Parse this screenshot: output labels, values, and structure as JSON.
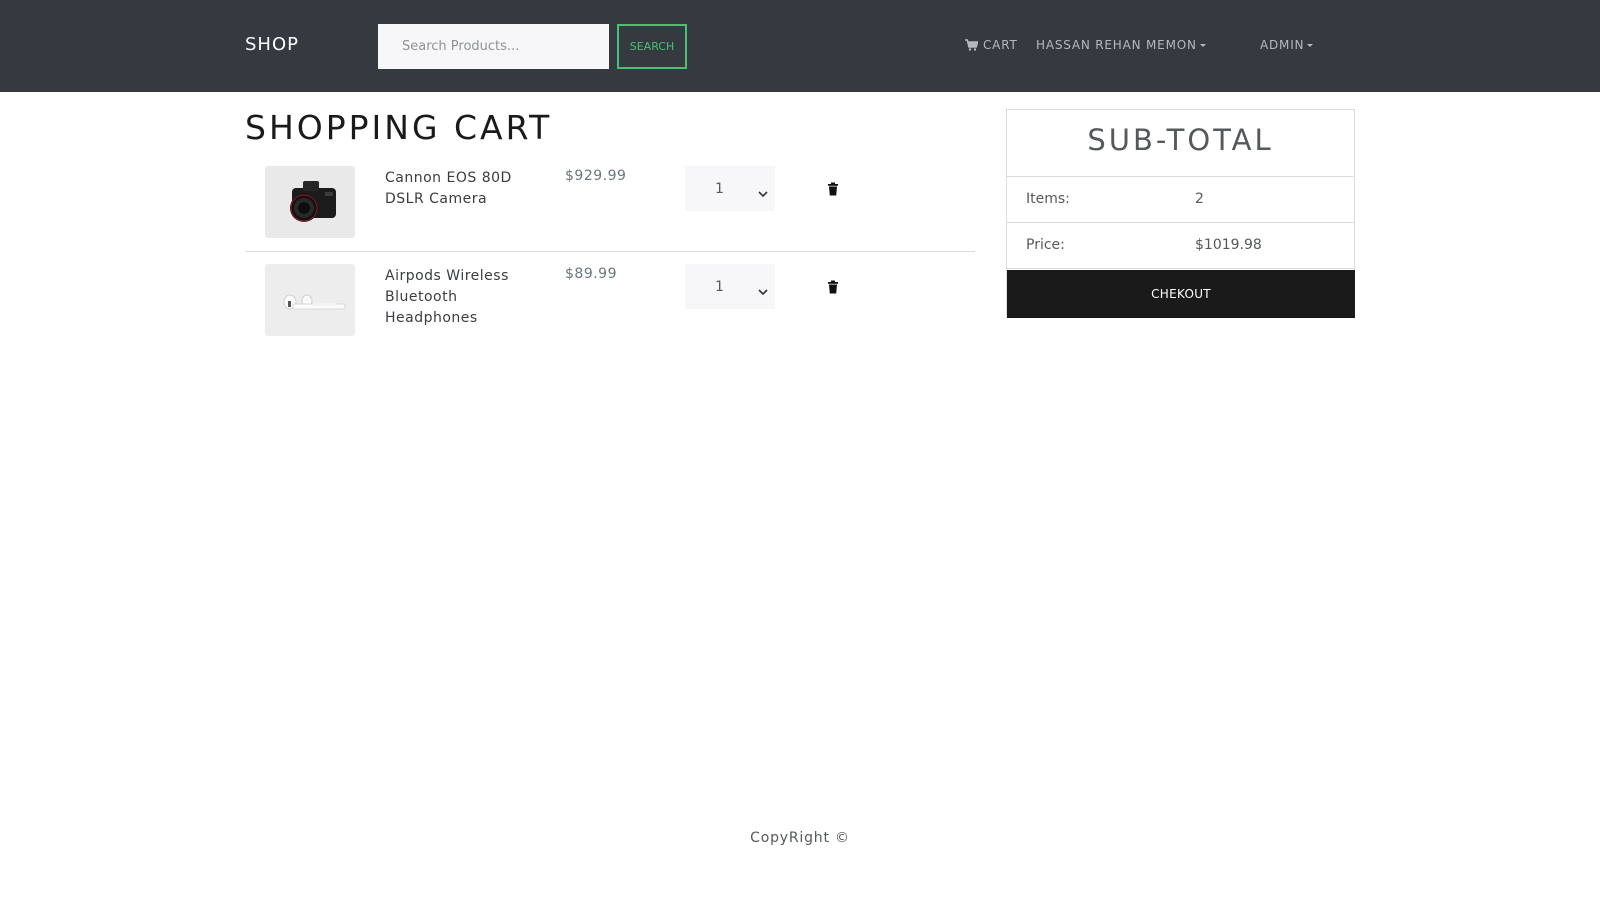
{
  "navbar": {
    "brand": "SHOP",
    "search_placeholder": "Search Products...",
    "search_label": "SEARCH",
    "cart_label": "CART",
    "user_label": "HASSAN REHAN MEMON",
    "admin_label": "ADMIN"
  },
  "page": {
    "title": "SHOPPING CART"
  },
  "cart": {
    "items": [
      {
        "name": "Cannon EOS 80D DSLR Camera",
        "price": "$929.99",
        "quantity": "1",
        "image": "camera"
      },
      {
        "name": "Airpods Wireless Bluetooth Headphones",
        "price": "$89.99",
        "quantity": "1",
        "image": "airpods"
      }
    ]
  },
  "summary": {
    "title": "SUB-TOTAL",
    "items_label": "Items:",
    "items_value": "2",
    "price_label": "Price:",
    "price_value": "$1019.98",
    "checkout_label": "CHEKOUT"
  },
  "footer": {
    "text": "CopyRight ©"
  },
  "colors": {
    "navbar": "#343a40",
    "accent": "#4bbf73",
    "checkout": "#1a1a1a"
  }
}
